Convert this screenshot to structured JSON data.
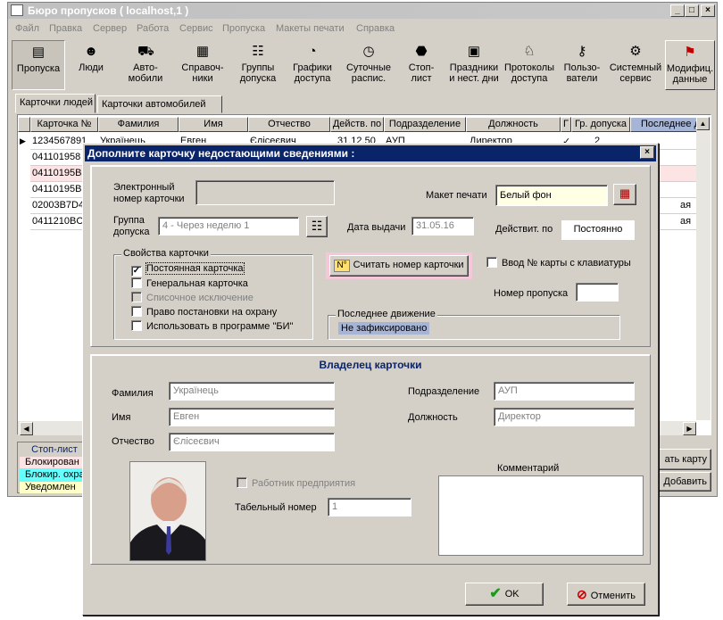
{
  "window": {
    "title": "Бюро пропусков ( localhost,1 )",
    "min": "_",
    "max": "□",
    "close": "×"
  },
  "menu": [
    "Файл",
    "Правка",
    "Сервер",
    "Работа",
    "Сервис",
    "Пропуска",
    "Макеты печати",
    "Справка"
  ],
  "toolbar": [
    {
      "label1": "Пропуска",
      "label2": "",
      "icon": "cards-icon"
    },
    {
      "label1": "Люди",
      "label2": "",
      "icon": "person-icon"
    },
    {
      "label1": "Авто-",
      "label2": "мобили",
      "icon": "car-icon"
    },
    {
      "label1": "Справоч-",
      "label2": "ники",
      "icon": "grid-icon"
    },
    {
      "label1": "Группы",
      "label2": "допуска",
      "icon": "group-icon"
    },
    {
      "label1": "Графики",
      "label2": "доступа",
      "icon": "clock-icon"
    },
    {
      "label1": "Суточные",
      "label2": "распис.",
      "icon": "clock-icon"
    },
    {
      "label1": "Стоп-",
      "label2": "лист",
      "icon": "stop-icon"
    },
    {
      "label1": "Праздники",
      "label2": "и нест. дни",
      "icon": "calendar-icon"
    },
    {
      "label1": "Протоколы",
      "label2": "доступа",
      "icon": "bell-icon"
    },
    {
      "label1": "Пользо-",
      "label2": "ватели",
      "icon": "key-icon"
    },
    {
      "label1": "Системный",
      "label2": "сервис",
      "icon": "service-icon"
    },
    {
      "label1": "Модифиц.",
      "label2": "данные",
      "icon": "flag-icon"
    }
  ],
  "tabs": {
    "people": "Карточки людей",
    "cars": "Карточки автомобилей"
  },
  "grid": {
    "headers": [
      "Карточка №",
      "Фамилия",
      "Имя",
      "Отчество",
      "Действ. по",
      "Подразделение",
      "Должность",
      "Г",
      "Гр. допуска",
      "Последнее д"
    ],
    "rows": [
      {
        "card": "1234567891",
        "surname": "Українець",
        "name": "Евген",
        "patronymic": "Єлісеєвич",
        "valid": "31.12.50",
        "dept": "АУП",
        "position": "Директор",
        "g": "✓",
        "group": "2",
        "last": ""
      },
      {
        "card": "041101958",
        "last": ""
      },
      {
        "card": "04110195B",
        "last": ""
      },
      {
        "card": "04110195B",
        "last": ""
      },
      {
        "card": "02003B7D4",
        "last": "ая"
      },
      {
        "card": "0411210BC",
        "last": "ая"
      }
    ]
  },
  "stoplist": {
    "title": "Стоп-лист",
    "items": [
      "Блокирован",
      "Блокир. охра",
      "Уведомлен"
    ]
  },
  "rightbuttons": {
    "card": "ать карту",
    "add": "Добавить"
  },
  "dialog": {
    "title": "Дополните карточку недостающими сведениями :",
    "close": "×",
    "el_card_label1": "Электронный",
    "el_card_label2": "номер карточки",
    "el_card_value": "",
    "print_label": "Макет печати",
    "print_value": "Белый фон",
    "group_label1": "Группа",
    "group_label2": "допуска",
    "group_value": "4  -  Через неделю 1",
    "issue_label": "Дата выдачи",
    "issue_value": "31.05.16",
    "valid_label": "Действит. по",
    "valid_value": "Постоянно",
    "props_title": "Свойства карточки",
    "props": [
      {
        "label": "Постоянная карточка",
        "checked": true,
        "disabled": false
      },
      {
        "label": "Генеральная карточка",
        "checked": false,
        "disabled": false
      },
      {
        "label": "Списочное исключение",
        "checked": false,
        "disabled": true
      },
      {
        "label": "Право постановки на охрану",
        "checked": false,
        "disabled": false
      },
      {
        "label": "Использовать в программе \"БИ\"",
        "checked": false,
        "disabled": false
      }
    ],
    "read_button_badge": "N°",
    "read_button": "Считать  номер карточки",
    "keyboard_label": "Ввод № карты с клавиатуры",
    "pass_label": "Номер пропуска",
    "pass_value": "",
    "last_move_title": "Последнее движение",
    "last_move_value": "Не зафиксировано",
    "owner_title": "Владелец карточки",
    "surname_label": "Фамилия",
    "surname_value": "Українець",
    "name_label": "Имя",
    "name_value": "Евген",
    "patr_label": "Отчество",
    "patr_value": "Єлісеєвич",
    "dept_label": "Подразделение",
    "dept_value": "АУП",
    "pos_label": "Должность",
    "pos_value": "Директор",
    "employee_label": "Работник предприятия",
    "tab_label": "Табельный номер",
    "tab_value": "1",
    "comment_label": "Комментарий",
    "comment_value": "",
    "ok": "OK",
    "cancel": "Отменить"
  }
}
